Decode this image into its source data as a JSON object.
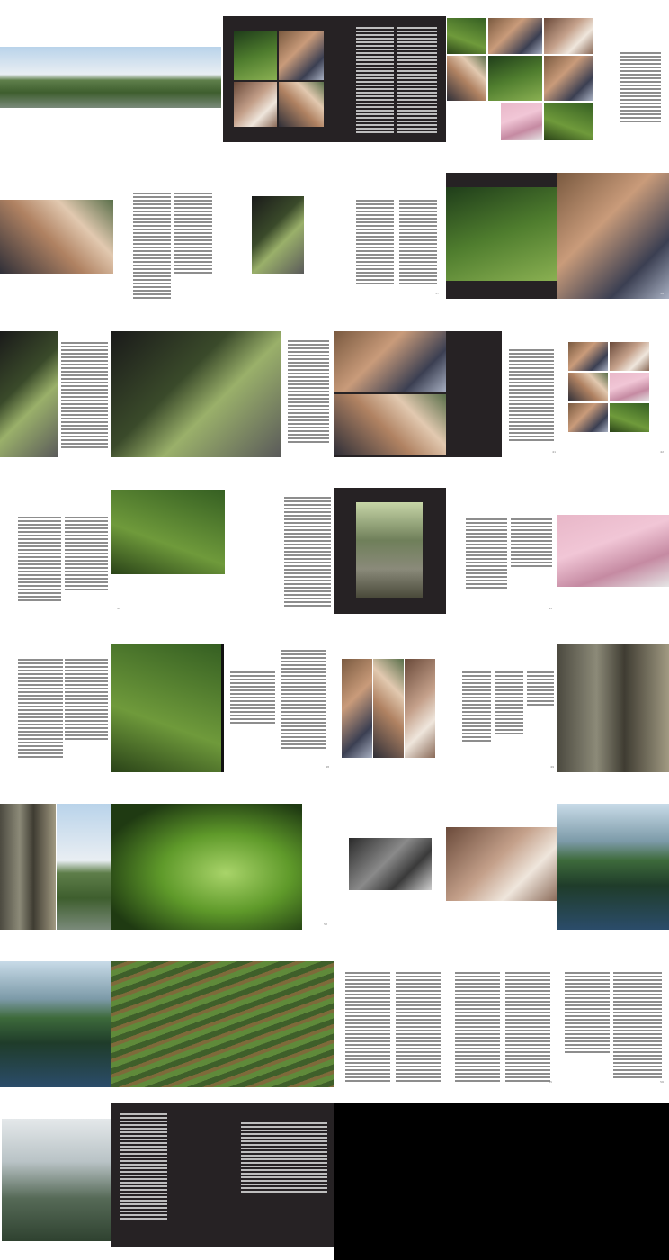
{
  "page_numbers": {
    "r2c": "37",
    "r2d": "38",
    "r3c": "41",
    "r3d": "42",
    "r4b": "44",
    "r4c": "45",
    "r5b": "48",
    "r5c": "49",
    "r6b": "52",
    "r7c": "55",
    "r7d": "56"
  },
  "photo_alts": {
    "landscape": "landscape-photo",
    "film_crew": "film-crew-photo",
    "portrait": "portrait-photo",
    "water_tank": "water-tank-photo"
  }
}
